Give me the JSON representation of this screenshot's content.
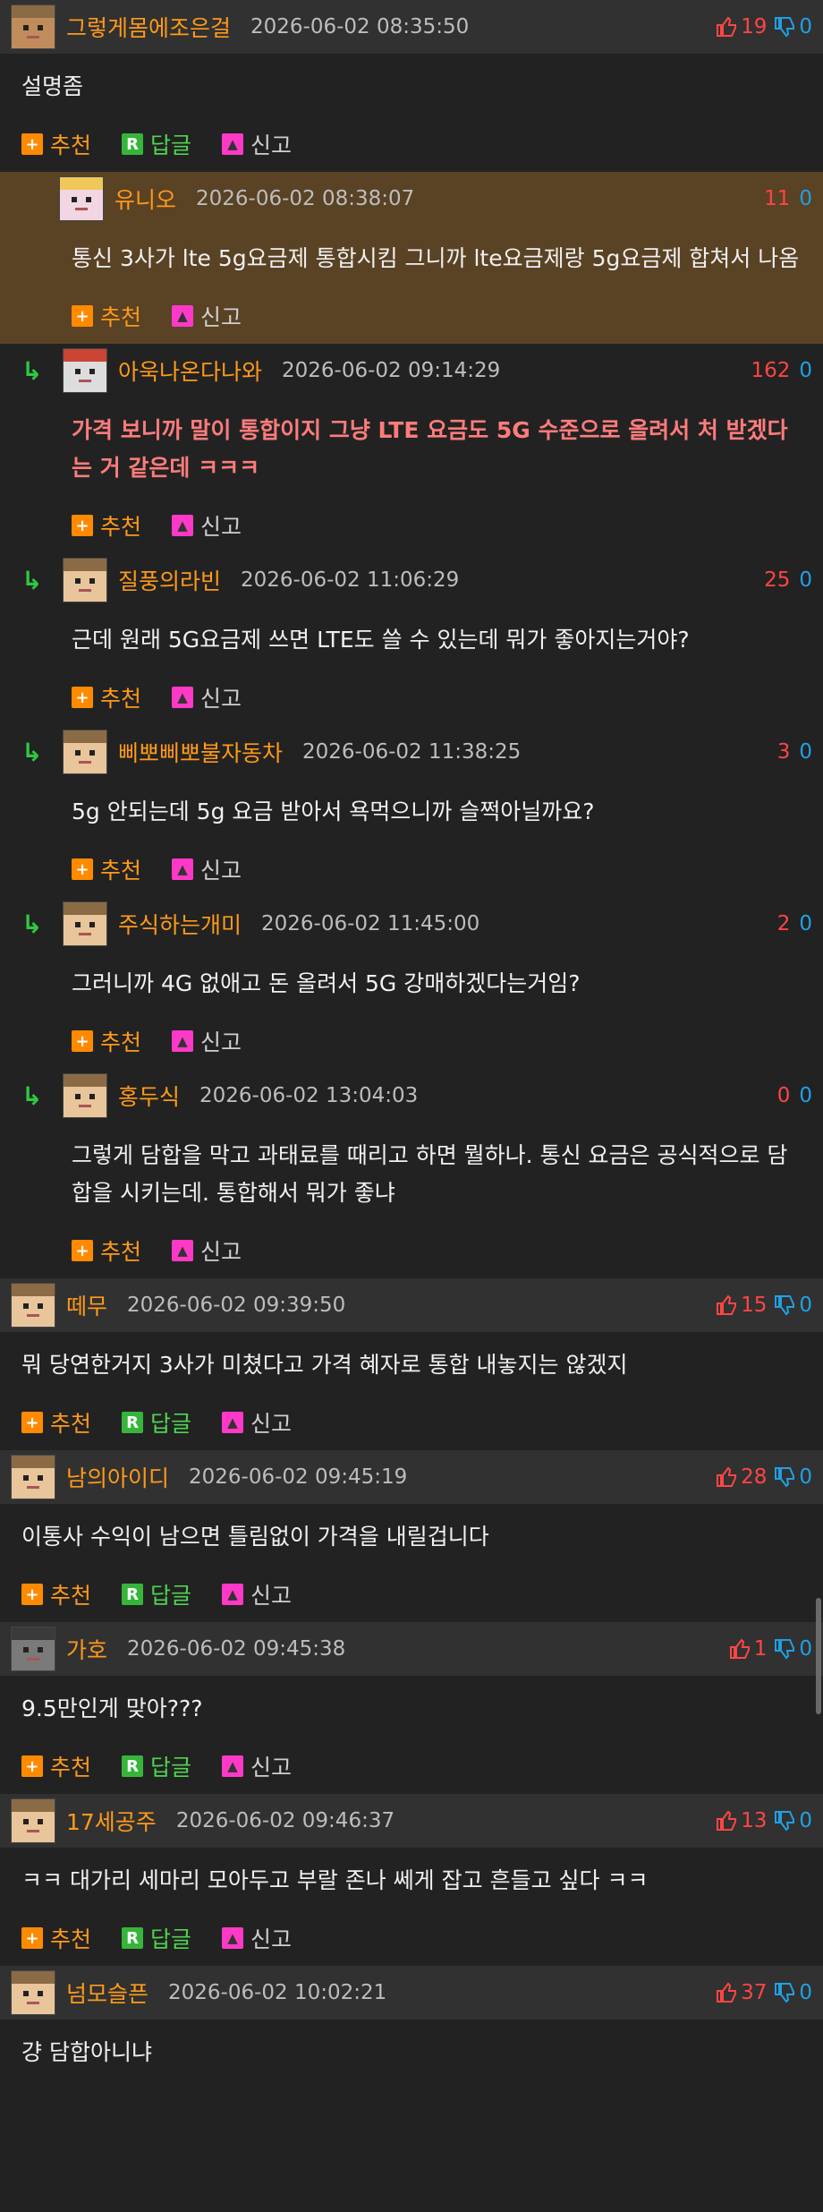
{
  "actions": {
    "recommend": "추천",
    "reply": "답글",
    "report": "신고"
  },
  "comments": [
    {
      "nick": "그렇게몸에조은걸",
      "date": "2026-06-02 08:35:50",
      "up": "19",
      "down": "0",
      "text": "설명좀",
      "type": "top",
      "avatar": "brown"
    },
    {
      "nick": "유니오",
      "date": "2026-06-02 08:38:07",
      "up": "11",
      "down": "0",
      "text": "통신 3사가 lte 5g요금제 통합시킴 그니까 lte요금제랑 5g요금제 합쳐서 나옴",
      "type": "best",
      "avatar": "pink"
    },
    {
      "nick": "아욱나온다나와",
      "date": "2026-06-02 09:14:29",
      "up": "162",
      "down": "0",
      "text": "가격 보니까 말이 통합이지 그냥 LTE 요금도 5G 수준으로 올려서 처 받겠다는 거 같은데 ㅋㅋㅋ",
      "type": "reply",
      "hot": true,
      "avatar": "white"
    },
    {
      "nick": "질풍의라빈",
      "date": "2026-06-02 11:06:29",
      "up": "25",
      "down": "0",
      "text": "근데 원래 5G요금제 쓰면 LTE도 쓸 수 있는데 뭐가 좋아지는거야?",
      "type": "reply",
      "avatar": "default"
    },
    {
      "nick": "삐뽀삐뽀불자동차",
      "date": "2026-06-02 11:38:25",
      "up": "3",
      "down": "0",
      "text": "5g 안되는데 5g 요금 받아서 욕먹으니까 슬쩍아닐까요?",
      "type": "reply",
      "avatar": "default"
    },
    {
      "nick": "주식하는개미",
      "date": "2026-06-02 11:45:00",
      "up": "2",
      "down": "0",
      "text": "그러니까 4G 없애고 돈 올려서 5G 강매하겠다는거임?",
      "type": "reply",
      "avatar": "default"
    },
    {
      "nick": "홍두식",
      "date": "2026-06-02 13:04:03",
      "up": "0",
      "down": "0",
      "text": "그렇게 담합을 막고 과태료를 때리고 하면 뭘하나. 통신 요금은 공식적으로 담합을 시키는데. 통합해서 뭐가 좋냐",
      "type": "reply",
      "avatar": "default"
    },
    {
      "nick": "떼무",
      "date": "2026-06-02 09:39:50",
      "up": "15",
      "down": "0",
      "text": "뭐 당연한거지 3사가 미쳤다고 가격 혜자로 통합 내놓지는 않겠지",
      "type": "top",
      "avatar": "default"
    },
    {
      "nick": "남의아이디",
      "date": "2026-06-02 09:45:19",
      "up": "28",
      "down": "0",
      "text": "이통사 수익이 남으면 틀림없이 가격을 내릴겁니다",
      "type": "top",
      "avatar": "default"
    },
    {
      "nick": "가호",
      "date": "2026-06-02 09:45:38",
      "up": "1",
      "down": "0",
      "text": "9.5만인게 맞아???",
      "type": "top",
      "avatar": "gray"
    },
    {
      "nick": "17세공주",
      "date": "2026-06-02 09:46:37",
      "up": "13",
      "down": "0",
      "text": "ㅋㅋ 대가리 세마리 모아두고 부랄 존나 쎄게 잡고 흔들고 싶다 ㅋㅋ",
      "type": "top",
      "avatar": "default"
    },
    {
      "nick": "넘모슬픈",
      "date": "2026-06-02 10:02:21",
      "up": "37",
      "down": "0",
      "text": "걍 담합아니냐",
      "type": "top",
      "avatar": "default",
      "noActions": true
    }
  ]
}
